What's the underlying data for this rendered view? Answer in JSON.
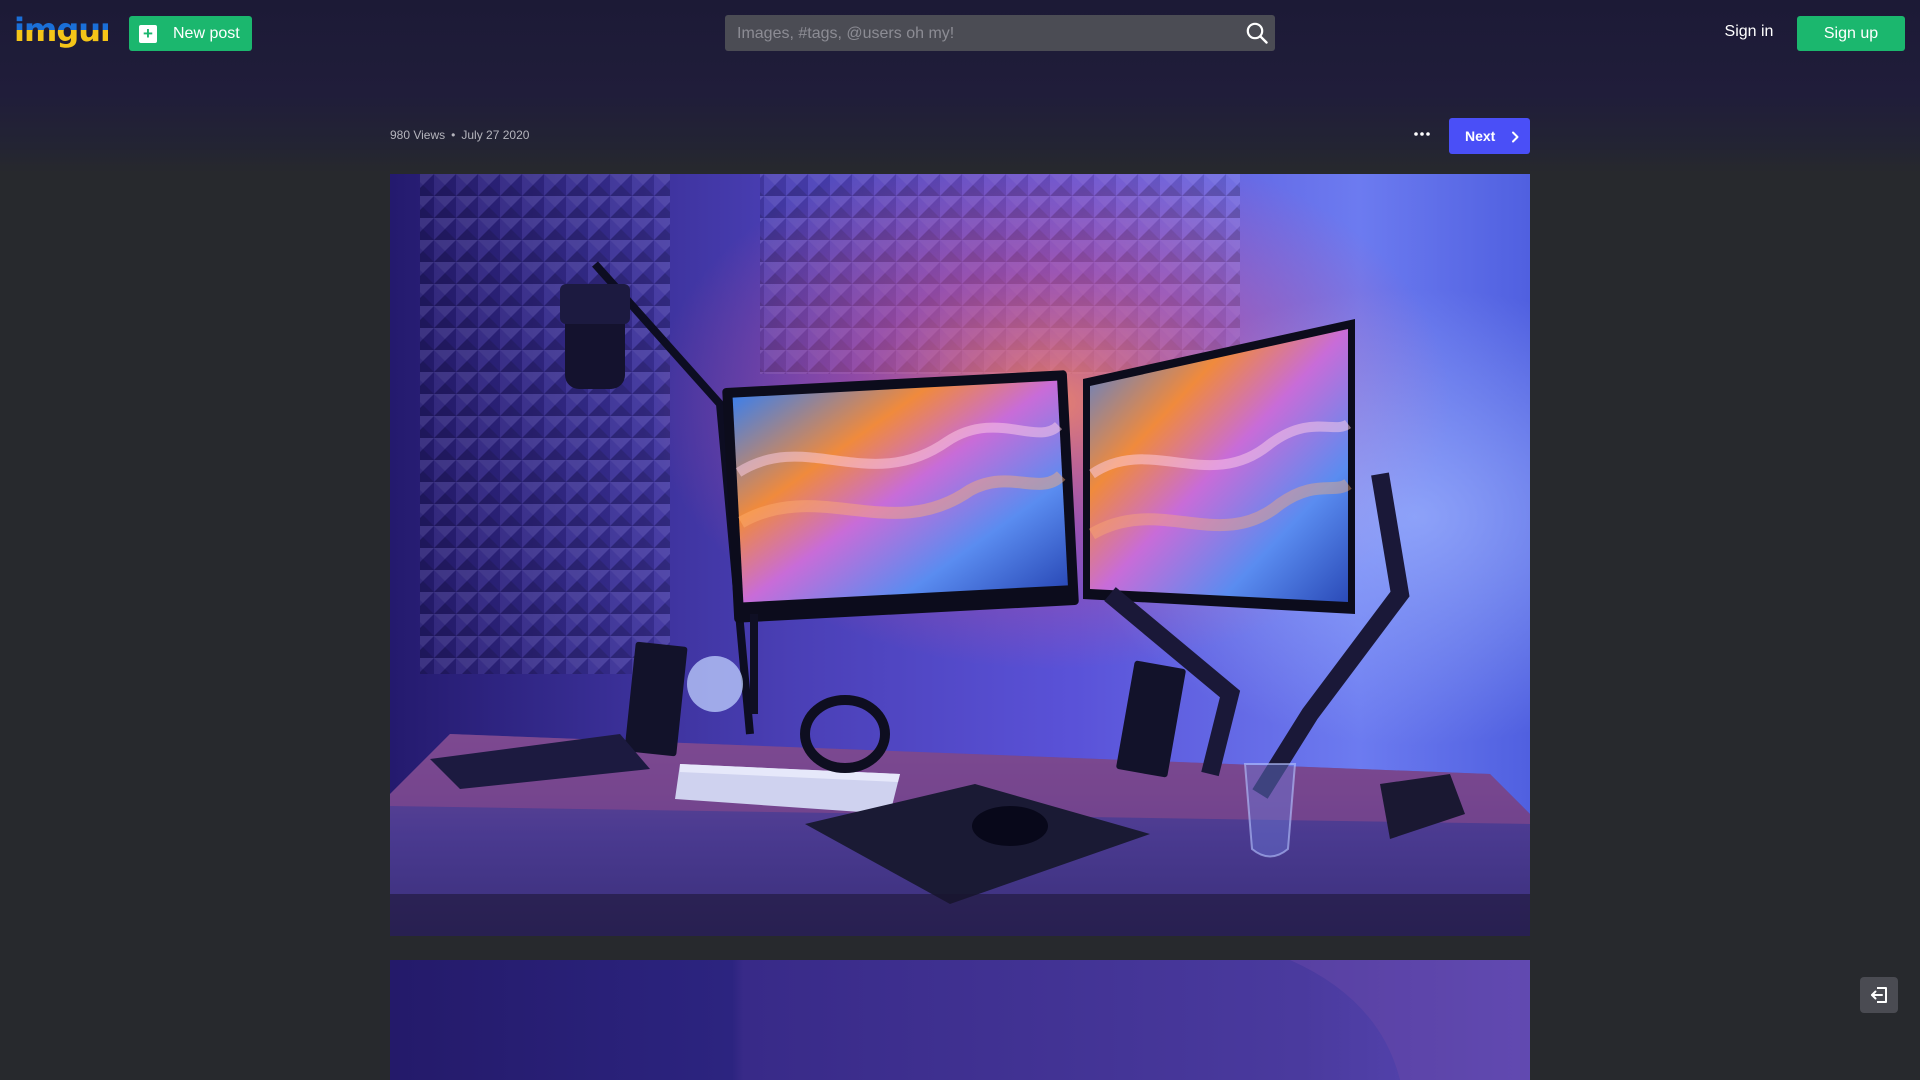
{
  "header": {
    "logo_text": "imgur",
    "new_post_label": "New post",
    "search_placeholder": "Images, #tags, @users oh my!",
    "sign_in_label": "Sign in",
    "sign_up_label": "Sign up"
  },
  "post": {
    "views": "980 Views",
    "separator": "•",
    "date": "July 27 2020",
    "next_label": "Next"
  },
  "colors": {
    "background": "#27292d",
    "header_background": "#1c1a36",
    "green": "#1bb76e",
    "next_blue": "#4a4ff7",
    "logo_blue": "#1a6fd8",
    "logo_yellow": "#f5c518"
  },
  "icons": {
    "new_post": "plus-icon",
    "search": "search-icon",
    "more": "more-horizontal-icon",
    "next": "chevron-right-icon",
    "exit": "exit-icon"
  }
}
